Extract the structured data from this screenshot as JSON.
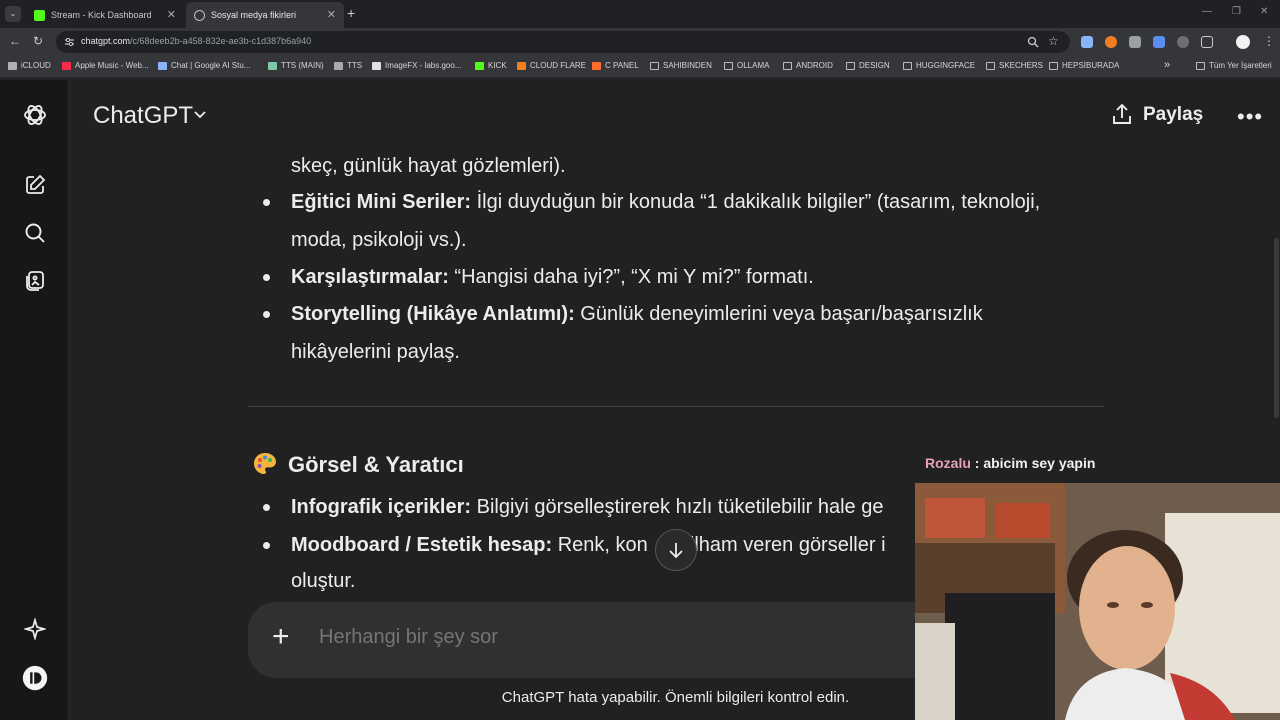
{
  "browser": {
    "tabs": [
      {
        "title": "Stream - Kick Dashboard",
        "active": false,
        "favicon_color": "#53fc18"
      },
      {
        "title": "Sosyal medya fikirleri",
        "active": true,
        "favicon_color": "#bdbdbd"
      }
    ],
    "url_domain": "chatgpt.com",
    "url_path": "/c/68deeb2b-a458-832e-ae3b-c1d387b6a940",
    "bookmarks": [
      {
        "label": "iCLOUD",
        "icon_color": "#b0b0b0"
      },
      {
        "label": "Apple Music - Web...",
        "icon_color": "#fa2d48"
      },
      {
        "label": "Chat | Google AI Stu...",
        "icon_color": "#8ab4f8"
      },
      {
        "label": "TTS (MAIN)",
        "icon_color": "#7ec8a3"
      },
      {
        "label": "TTS",
        "icon_color": "#aaaaaa"
      },
      {
        "label": "ImageFX - labs.goo...",
        "icon_color": "#e0e0e0"
      },
      {
        "label": "KICK",
        "icon_color": "#53fc18"
      },
      {
        "label": "CLOUD FLARE",
        "icon_color": "#f38020"
      },
      {
        "label": "C PANEL",
        "icon_color": "#ff6c2c"
      },
      {
        "label": "SAHIBINDEN",
        "icon_color": "folder"
      },
      {
        "label": "OLLAMA",
        "icon_color": "folder"
      },
      {
        "label": "ANDROID",
        "icon_color": "folder"
      },
      {
        "label": "DESIGN",
        "icon_color": "folder"
      },
      {
        "label": "HUGGINGFACE",
        "icon_color": "folder"
      },
      {
        "label": "SKECHERS",
        "icon_color": "folder"
      },
      {
        "label": "HEPSİBURADA",
        "icon_color": "folder"
      }
    ],
    "overflow_label": "»",
    "all_bookmarks_label": "Tüm Yer İşaretleri"
  },
  "app": {
    "model_title": "ChatGPT",
    "share_label": "Paylaş",
    "more_label": "•••"
  },
  "content": {
    "lines": [
      {
        "bold": "",
        "text": "skeç, günlük hayat gözlemleri)."
      },
      {
        "bold": "Eğitici Mini Seriler:",
        "text": " İlgi duyduğun bir konuda “1 dakikalık bilgiler” (tasarım, teknoloji,"
      },
      {
        "bold": "",
        "text": "moda, psikoloji vs.)."
      },
      {
        "bold": "Karşılaştırmalar:",
        "text": " “Hangisi daha iyi?”, “X mi Y mi?” formatı."
      },
      {
        "bold": "Storytelling (Hikâye Anlatımı):",
        "text": " Günlük deneyimlerini veya başarı/başarısızlık"
      },
      {
        "bold": "",
        "text": "hikâyelerini paylaş."
      }
    ],
    "section_emoji": "🎨",
    "section_title": "Görsel & Yaratıcı",
    "section_lines": [
      {
        "bold": "Infografik içerikler:",
        "text": " Bilgiyi görselleştirerek hızlı tüketilebilir hale ge"
      },
      {
        "bold": "Moodboard / Estetik hesap:",
        "text": " Renk, kon",
        "after": ", ilham veren görseller i"
      },
      {
        "bold": "",
        "text": "oluştur."
      }
    ]
  },
  "composer": {
    "placeholder": "Herhangi bir şey sor"
  },
  "disclaimer": "ChatGPT hata yapabilir. Önemli bilgileri kontrol edin.",
  "stream_chat": {
    "user": "Rozalu",
    "message": " : abicim sey yapin"
  }
}
